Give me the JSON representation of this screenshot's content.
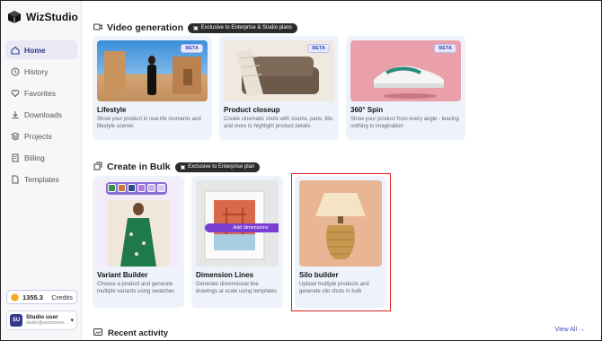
{
  "app": {
    "name": "WizStudio"
  },
  "sidebar": {
    "items": [
      {
        "label": "Home",
        "icon": "home-icon",
        "active": true
      },
      {
        "label": "History",
        "icon": "clock-icon",
        "active": false
      },
      {
        "label": "Favorites",
        "icon": "heart-icon",
        "active": false
      },
      {
        "label": "Downloads",
        "icon": "download-icon",
        "active": false
      },
      {
        "label": "Projects",
        "icon": "layers-icon",
        "active": false
      },
      {
        "label": "Billing",
        "icon": "receipt-icon",
        "active": false
      },
      {
        "label": "Templates",
        "icon": "file-icon",
        "active": false
      }
    ],
    "credits": {
      "value": "1355.3",
      "label": "Credits"
    },
    "user": {
      "initials": "SU",
      "name": "Studio user",
      "email": "studio@wizcomme..."
    }
  },
  "video": {
    "title": "Video generation",
    "badge": "Exclusive to Enterprise & Studio plans",
    "cards": [
      {
        "title": "Lifestyle",
        "desc": "Show your product in real-life moments and lifestyle scenes",
        "badge": "BETA"
      },
      {
        "title": "Product closeup",
        "desc": "Create cinematic shots with zooms, pans, tilts and more to highlight product details",
        "badge": "BETA"
      },
      {
        "title": "360° Spin",
        "desc": "Show your product from every angle - leaving nothing to imagination",
        "badge": "BETA"
      }
    ]
  },
  "bulk": {
    "title": "Create in Bulk",
    "badge": "Exclusive to Enterprise plan",
    "cards": [
      {
        "title": "Variant Builder",
        "desc": "Choose a product and generate multiple variants using swatches"
      },
      {
        "title": "Dimension Lines",
        "desc": "Generate dimensional line drawings at scale using templates",
        "overlay": "Add dimensions"
      },
      {
        "title": "Silo builder",
        "desc": "Upload multiple products and generate silo shots in bulk"
      }
    ]
  },
  "recent": {
    "title": "Recent activity",
    "view_all": "View All"
  },
  "colors": {
    "accent": "#2f3a8f",
    "highlight": "#e02020"
  }
}
